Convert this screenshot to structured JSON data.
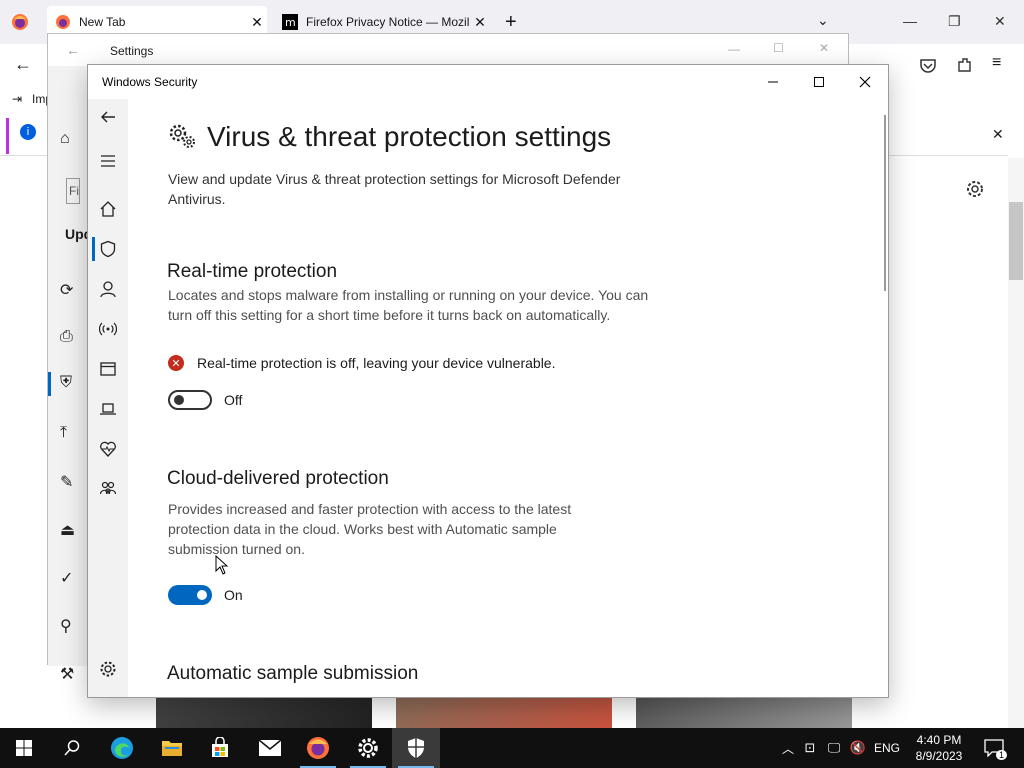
{
  "firefox": {
    "tabs": [
      {
        "label": "New Tab"
      },
      {
        "label": "Firefox Privacy Notice — Mozilla"
      }
    ],
    "bookmark_text": "Imp",
    "side_labels": {
      "update": "Upd",
      "search": "Fi"
    }
  },
  "settings_window": {
    "title": "Settings"
  },
  "security_window": {
    "title": "Windows Security",
    "page_title": "Virus & threat protection settings",
    "page_description": "View and update Virus & threat protection settings for Microsoft Defender Antivirus.",
    "realtime": {
      "heading": "Real-time protection",
      "description": "Locates and stops malware from installing or running on your device. You can turn off this setting for a short time before it turns back on automatically.",
      "warning": "Real-time protection is off, leaving your device vulnerable.",
      "toggle_label": "Off",
      "toggle_state": "off"
    },
    "cloud": {
      "heading": "Cloud-delivered protection",
      "description": "Provides increased and faster protection with access to the latest protection data in the cloud. Works best with Automatic sample submission turned on.",
      "toggle_label": "On",
      "toggle_state": "on"
    },
    "sample": {
      "heading": "Automatic sample submission"
    },
    "nav_icons": [
      "back-icon",
      "menu-icon",
      "home-icon",
      "shield-icon",
      "account-icon",
      "firewall-icon",
      "app-browser-icon",
      "device-security-icon",
      "health-icon",
      "family-icon",
      "settings-icon"
    ]
  },
  "taskbar": {
    "apps": [
      "start",
      "search",
      "edge",
      "file-explorer",
      "store",
      "mail",
      "firefox",
      "settings",
      "windows-security"
    ],
    "language": "ENG",
    "time": "4:40 PM",
    "date": "8/9/2023",
    "notification_count": "1"
  },
  "colors": {
    "accent": "#0067c0",
    "error": "#c42b1c",
    "taskbar": "#101010"
  }
}
